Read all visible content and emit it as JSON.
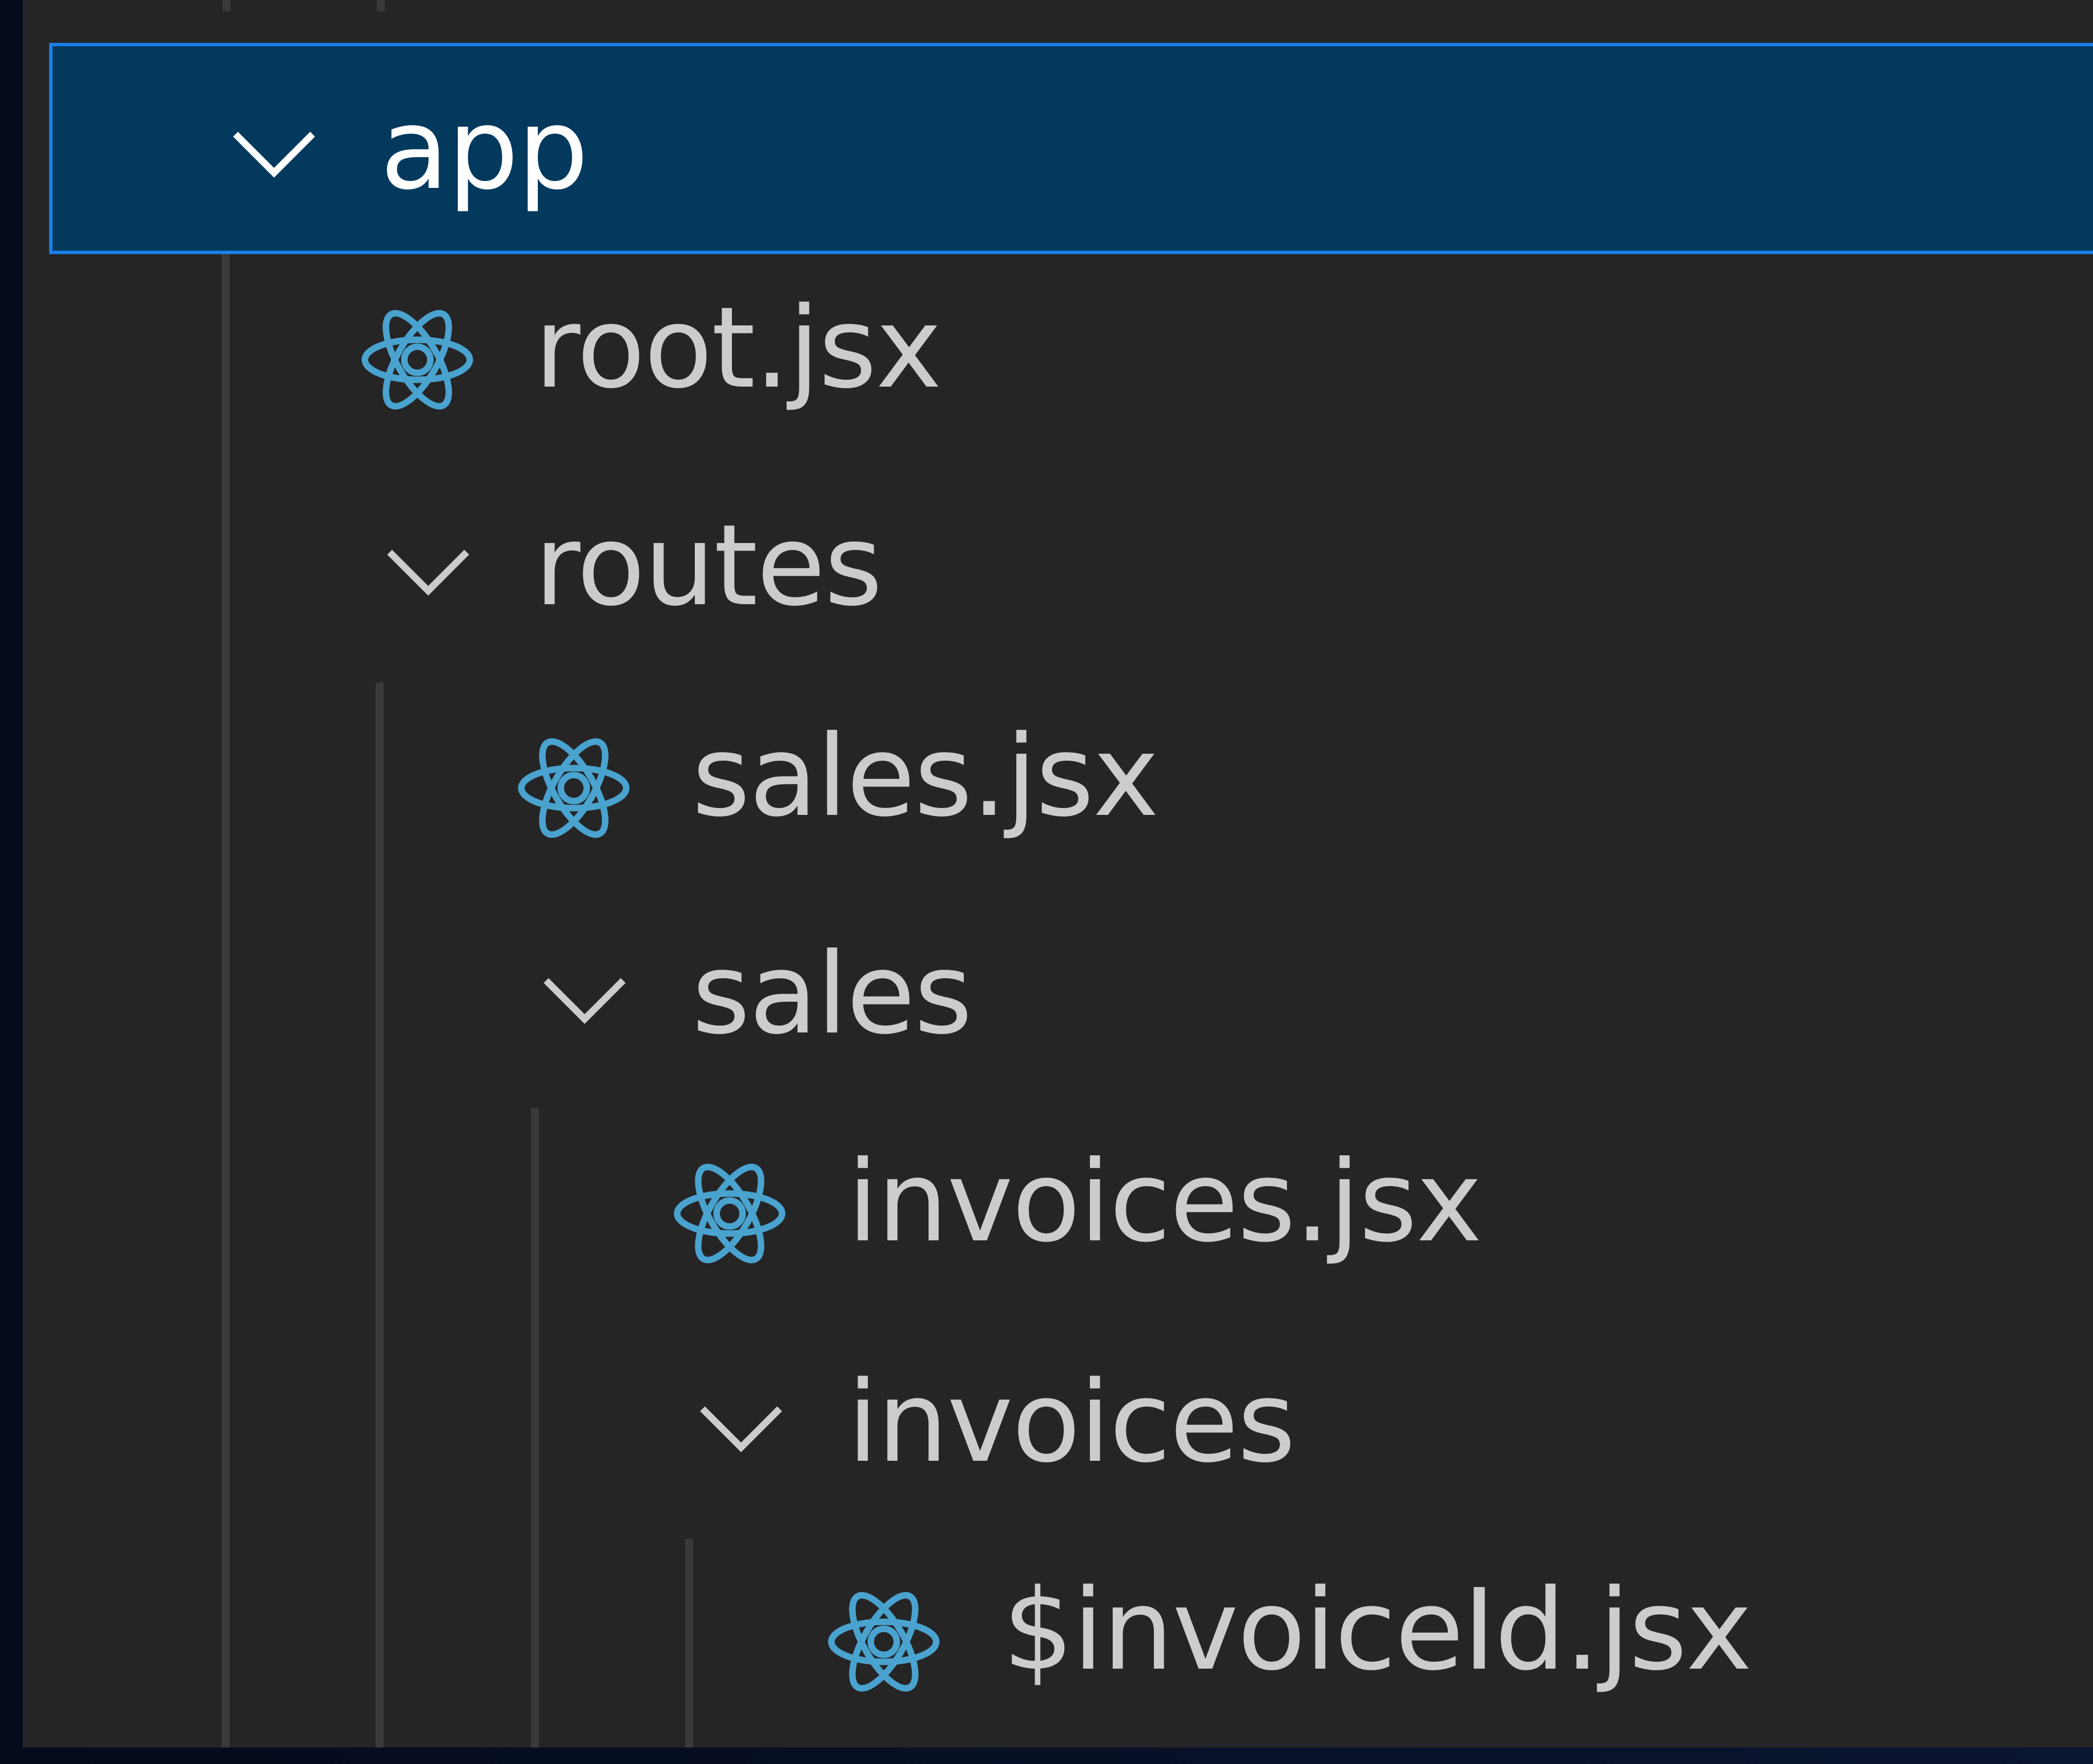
{
  "explorer": {
    "items": [
      {
        "label": "app",
        "kind": "folder",
        "expanded": true,
        "selected": true,
        "depth": 0
      },
      {
        "label": "root.jsx",
        "kind": "file",
        "icon": "react-icon",
        "depth": 1
      },
      {
        "label": "routes",
        "kind": "folder",
        "expanded": true,
        "depth": 1
      },
      {
        "label": "sales.jsx",
        "kind": "file",
        "icon": "react-icon",
        "depth": 2
      },
      {
        "label": "sales",
        "kind": "folder",
        "expanded": true,
        "depth": 2
      },
      {
        "label": "invoices.jsx",
        "kind": "file",
        "icon": "react-icon",
        "depth": 3
      },
      {
        "label": "invoices",
        "kind": "folder",
        "expanded": true,
        "depth": 3
      },
      {
        "label": "$invoiceId.jsx",
        "kind": "file",
        "icon": "react-icon",
        "depth": 4
      }
    ]
  },
  "colors": {
    "background": "#252526",
    "selection_background": "#04395e",
    "selection_border": "#1a7ee6",
    "text": "#cccccc",
    "selected_text": "#ffffff",
    "react_icon": "#4aa3cf",
    "indent_guide": "#3a3a3a"
  }
}
